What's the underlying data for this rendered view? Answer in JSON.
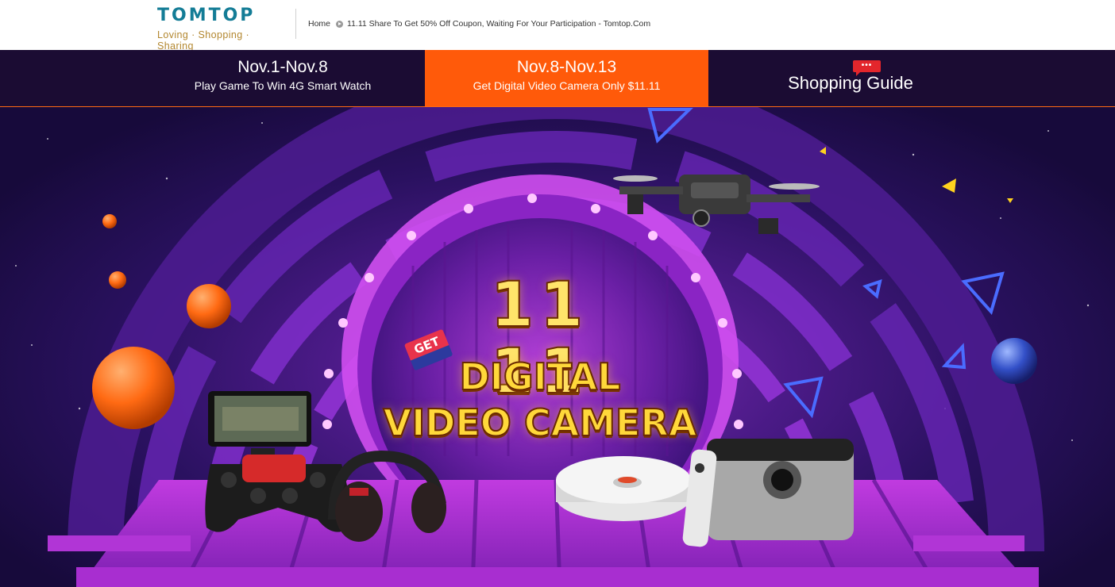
{
  "header": {
    "logo_title": "TOMTOP",
    "logo_tagline": "Loving · Shopping · Sharing",
    "breadcrumb": {
      "home": "Home",
      "current": "11.11 Share To Get 50% Off Coupon, Waiting For Your Participation - Tomtop.Com"
    }
  },
  "tabs": [
    {
      "date": "Nov.1-Nov.8",
      "desc": "Play Game To Win 4G Smart Watch"
    },
    {
      "date": "Nov.8-Nov.13",
      "desc": "Get Digital Video Camera Only $11.11"
    }
  ],
  "guide": {
    "label": "Shopping Guide",
    "badge": "•••"
  },
  "banner": {
    "headline_number": "11 11",
    "get_tag": "GET",
    "line1": "DIGITAL",
    "line2": "VIDEO CAMERA"
  },
  "colors": {
    "brand_teal": "#137c96",
    "brand_gold": "#b3872f",
    "tab_bar": "#1b0c33",
    "tab_active": "#ff5a0a",
    "accent_orange": "#ff6a13"
  }
}
